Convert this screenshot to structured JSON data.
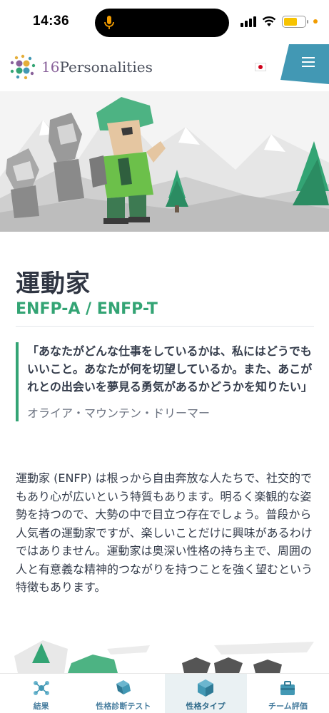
{
  "status_bar": {
    "time": "14:36",
    "icons": [
      "microphone-icon",
      "signal-icon",
      "wifi-icon",
      "battery-icon"
    ],
    "colors": {
      "mic": "#f19b00",
      "battery": "#f7c300"
    }
  },
  "header": {
    "logo_number": "16",
    "logo_text": "Personalities",
    "language_flag": "japan-flag-icon",
    "menu_icon": "hamburger-menu-icon",
    "menu_tab_color": "#4298b4"
  },
  "article": {
    "title": "運動家",
    "subtitle": "ENFP-A / ENFP-T",
    "quote": "「あなたがどんな仕事をしているかは、私にはどうでもいいこと。あなたが何を切望しているか。また、あこがれとの出会いを夢見る勇気があるかどうかを知りたい」",
    "quote_author": "オライア・マウンテン・ドリーマー",
    "body": "運動家 (ENFP) は根っから自由奔放な人たちで、社交的でもあり心が広いという特質もあります。明るく楽観的な姿勢を持つので、大勢の中で目立つ存在でしょう。普段から人気者の運動家ですが、楽しいことだけに興味があるわけではありません。運動家は奥深い性格の持ち主で、周囲の人と有意義な精神的つながりを持つことを強く望むという特徴もあります。",
    "accent_color": "#33a474"
  },
  "bottom_nav": [
    {
      "label": "結果",
      "icon": "results-icon",
      "active": false
    },
    {
      "label": "性格診断テスト",
      "icon": "test-icon",
      "active": false
    },
    {
      "label": "性格タイプ",
      "icon": "types-icon",
      "active": true
    },
    {
      "label": "チーム評価",
      "icon": "team-icon",
      "active": false
    }
  ]
}
